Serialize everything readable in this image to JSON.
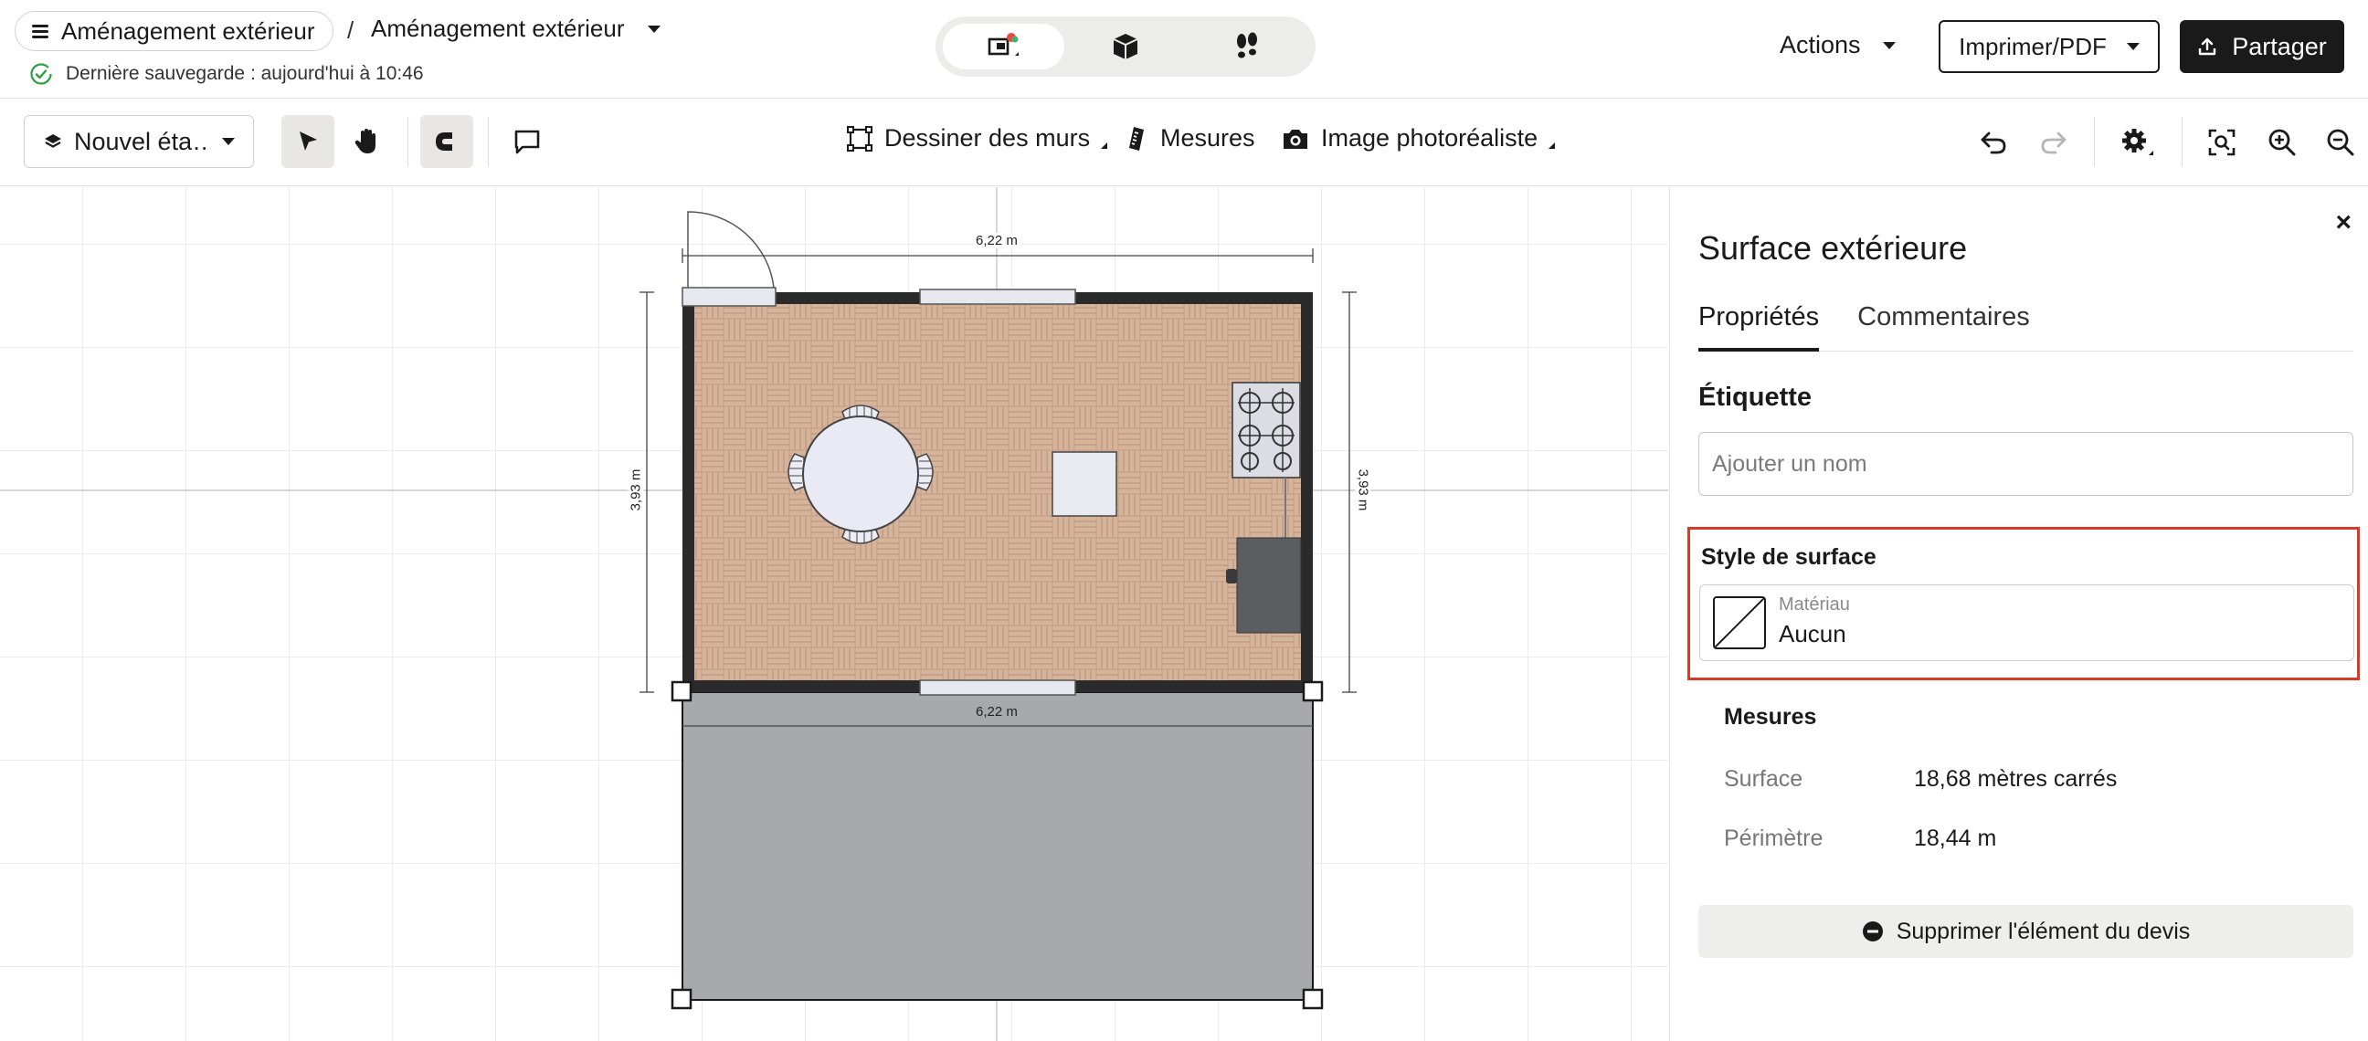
{
  "header": {
    "project_label": "Aménagement extérieur",
    "separator": "/",
    "design_label": "Aménagement extérieur",
    "save_status": "Dernière sauvegarde : aujourd'hui à 10:46",
    "actions_label": "Actions",
    "print_label": "Imprimer/PDF",
    "share_label": "Partager",
    "view_modes": [
      "2d-plan-icon",
      "3d-box-icon",
      "walkthrough-footsteps-icon"
    ],
    "active_view": 0
  },
  "toolbar": {
    "floor_label": "Nouvel éta…",
    "draw_walls_label": "Dessiner des murs",
    "measures_label": "Mesures",
    "photo_label": "Image photoréaliste"
  },
  "canvas": {
    "dim_top": "6,22 m",
    "dim_left": "3,93 m",
    "dim_right": "3,93 m",
    "dim_bottom": "6,22 m"
  },
  "panel": {
    "title": "Surface extérieure",
    "tabs": [
      {
        "label": "Propriétés",
        "active": true
      },
      {
        "label": "Commentaires",
        "active": false
      }
    ],
    "label_heading": "Étiquette",
    "name_placeholder": "Ajouter un nom",
    "surface_style_heading": "Style de surface",
    "material_label": "Matériau",
    "material_value": "Aucun",
    "measures_heading": "Mesures",
    "measures": [
      {
        "key": "Surface",
        "value": "18,68 mètres carrés"
      },
      {
        "key": "Périmètre",
        "value": "18,44 m"
      }
    ],
    "remove_label": "Supprimer l'élément du devis"
  },
  "colors": {
    "accent_highlight": "#d93a28",
    "status_green": "#2ea043",
    "dark_button": "#1a1a1a",
    "outdoor_surface": "#a8a9ad",
    "parquet": "#d8b49a"
  }
}
